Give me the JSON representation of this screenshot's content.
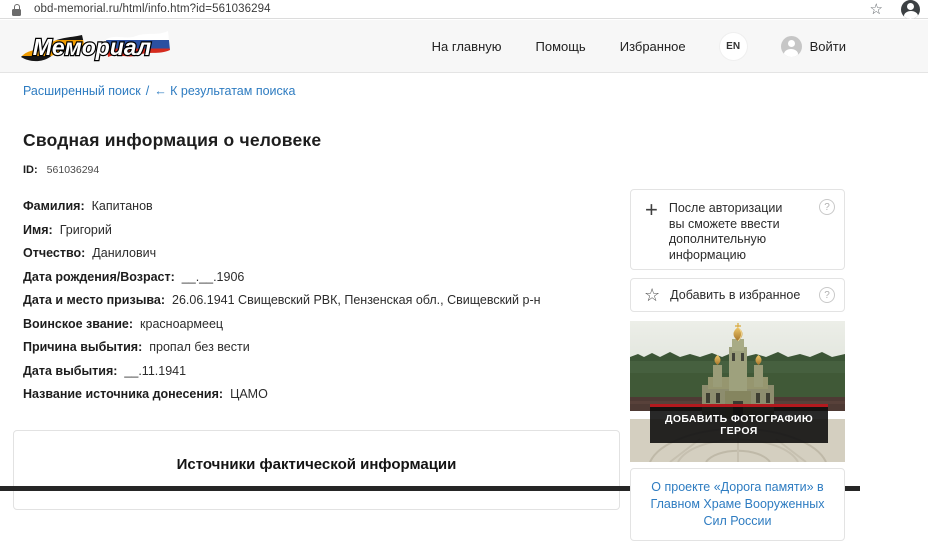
{
  "browser": {
    "url": "obd-memorial.ru/html/info.htm?id=561036294"
  },
  "header": {
    "logo_text": "Мемориал",
    "nav": [
      {
        "label": "На главную"
      },
      {
        "label": "Помощь"
      },
      {
        "label": "Избранное"
      }
    ],
    "lang_button": "EN",
    "login_label": "Войти"
  },
  "breadcrumb": {
    "advanced_search": "Расширенный поиск",
    "separator": "/",
    "back_to_results": "← К результатам поиска"
  },
  "person": {
    "title": "Сводная информация о человеке",
    "id_label": "ID:",
    "id_value": "561036294",
    "fields": [
      {
        "label": "Фамилия:",
        "value": "Капитанов"
      },
      {
        "label": "Имя:",
        "value": "Григорий"
      },
      {
        "label": "Отчество:",
        "value": "Данилович"
      },
      {
        "label": "Дата рождения/Возраст:",
        "value": "__.__.1906"
      },
      {
        "label": "Дата и место призыва:",
        "value": "26.06.1941 Свищевский РВК, Пензенская обл., Свищевский р-н"
      },
      {
        "label": "Воинское звание:",
        "value": "красноармеец"
      },
      {
        "label": "Причина выбытия:",
        "value": "пропал без вести"
      },
      {
        "label": "Дата выбытия:",
        "value": "__.11.1941"
      },
      {
        "label": "Название источника донесения:",
        "value": "ЦАМО"
      }
    ]
  },
  "sidebar": {
    "auth_note": "После авторизации вы сможете ввести дополнительную информацию",
    "add_favorite_label": "Добавить в избранное",
    "add_photo_button": "ДОБАВИТЬ ФОТОГРАФИЮ ГЕРОЯ",
    "project_link": "О проекте «Дорога памяти» в Главном Храме Вооруженных Сил России"
  },
  "sources_section": {
    "title": "Источники фактической информации"
  },
  "colors": {
    "link_blue": "#2e7cc1",
    "banner_red": "#b3191e",
    "header_bg": "#f7f7f7",
    "ribbon_orange": "#ef9b00",
    "flag_blue": "#2b50a1",
    "flag_red": "#d52b1e"
  }
}
